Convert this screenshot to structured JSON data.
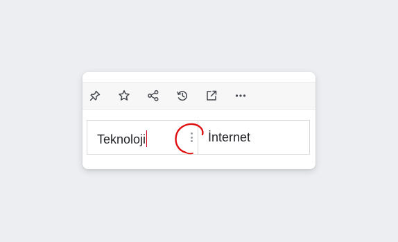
{
  "toolbar": {
    "tools": [
      {
        "name": "pin-icon",
        "label": "Pin"
      },
      {
        "name": "star-icon",
        "label": "Favorite"
      },
      {
        "name": "share-icon",
        "label": "Share"
      },
      {
        "name": "history-icon",
        "label": "History"
      },
      {
        "name": "open-external-icon",
        "label": "Open in new window"
      },
      {
        "name": "more-icon",
        "label": "More"
      }
    ]
  },
  "table": {
    "cells": [
      "Teknoloji",
      "İnternet"
    ]
  },
  "colors": {
    "caret": "#d0021b",
    "annotation": "#e01010",
    "icon": "#44464d"
  }
}
